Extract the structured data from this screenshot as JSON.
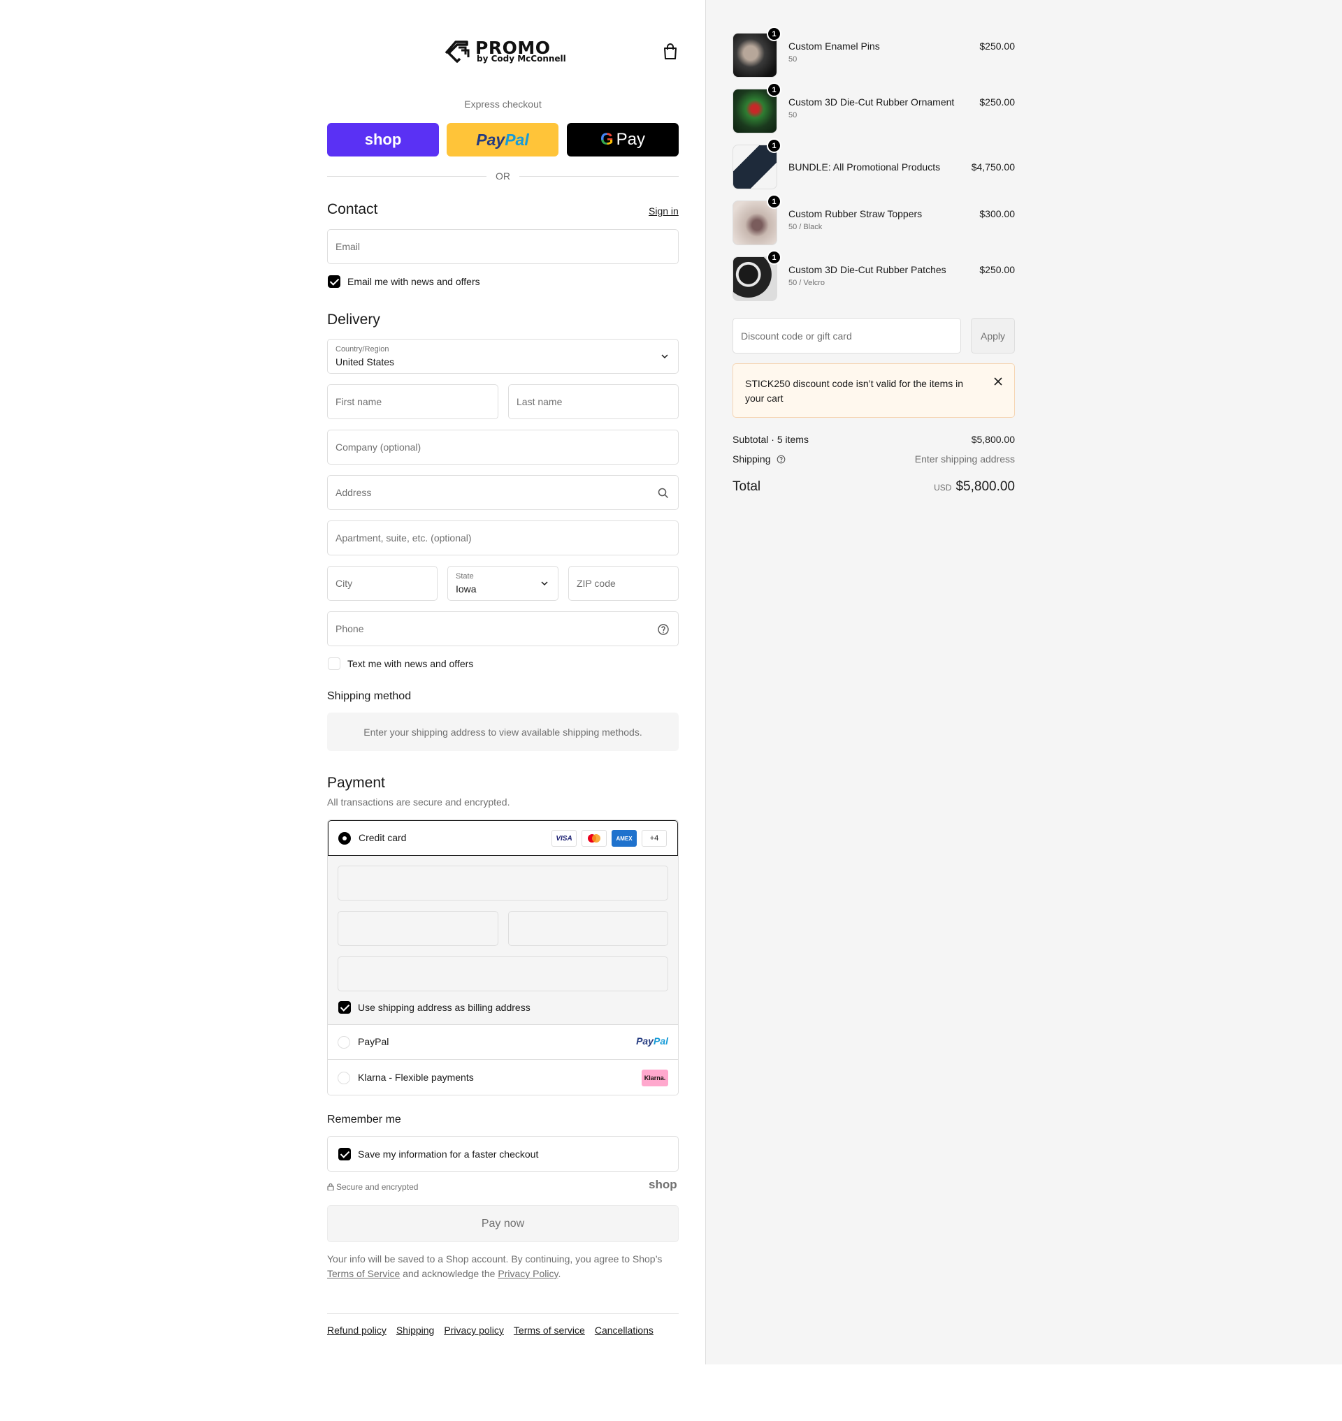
{
  "header": {
    "brand": "PROMO",
    "brand_sub": "by Cody McConnell"
  },
  "express": {
    "label": "Express checkout",
    "shop_label": "shop",
    "paypal_a": "Pay",
    "paypal_b": "Pal",
    "gpay_g": "G",
    "gpay_label": "Pay",
    "or_label": "OR"
  },
  "contact": {
    "title": "Contact",
    "sign_in": "Sign in",
    "email_placeholder": "Email",
    "news_label": "Email me with news and offers"
  },
  "delivery": {
    "title": "Delivery",
    "country_label": "Country/Region",
    "country_value": "United States",
    "first_name": "First name",
    "last_name": "Last name",
    "company": "Company (optional)",
    "address": "Address",
    "apartment": "Apartment, suite, etc. (optional)",
    "city": "City",
    "state_label": "State",
    "state_value": "Iowa",
    "zip": "ZIP code",
    "phone": "Phone",
    "text_label": "Text me with news and offers"
  },
  "shipping": {
    "title": "Shipping method",
    "message": "Enter your shipping address to view available shipping methods."
  },
  "payment": {
    "title": "Payment",
    "subtitle": "All transactions are secure and encrypted.",
    "credit_card": "Credit card",
    "card_brands": [
      "VISA",
      "MC",
      "AMEX",
      "+4"
    ],
    "billing_same": "Use shipping address as billing address",
    "paypal": "PayPal",
    "paypal_logo_a": "Pay",
    "paypal_logo_b": "Pal",
    "klarna": "Klarna - Flexible payments",
    "klarna_logo": "Klarna."
  },
  "remember": {
    "title": "Remember me",
    "save_label": "Save my information for a faster checkout",
    "secure": "Secure and encrypted",
    "shop": "shop"
  },
  "pay_now": "Pay now",
  "legal": {
    "part1": "Your info will be saved to a Shop account. By continuing, you agree to Shop’s ",
    "tos": "Terms of Service",
    "part2": " and acknowledge the ",
    "privacy": "Privacy Policy",
    "part3": "."
  },
  "footer": [
    "Refund policy",
    "Shipping",
    "Privacy policy",
    "Terms of service",
    "Cancellations"
  ],
  "cart": {
    "items": [
      {
        "name": "Custom Enamel Pins",
        "variant": "50",
        "price": "$250.00",
        "qty": "1"
      },
      {
        "name": "Custom 3D Die-Cut Rubber Ornament",
        "variant": "50",
        "price": "$250.00",
        "qty": "1"
      },
      {
        "name": "BUNDLE: All Promotional Products",
        "variant": "",
        "price": "$4,750.00",
        "qty": "1"
      },
      {
        "name": "Custom Rubber Straw Toppers",
        "variant": "50 / Black",
        "price": "$300.00",
        "qty": "1"
      },
      {
        "name": "Custom 3D Die-Cut Rubber Patches",
        "variant": "50 / Velcro",
        "price": "$250.00",
        "qty": "1"
      }
    ],
    "discount_placeholder": "Discount code or gift card",
    "apply": "Apply",
    "error": "STICK250 discount code isn’t valid for the items in your cart",
    "subtotal_label": "Subtotal · 5 items",
    "subtotal_value": "$5,800.00",
    "shipping_label": "Shipping",
    "shipping_value": "Enter shipping address",
    "total_label": "Total",
    "currency": "USD",
    "total_value": "$5,800.00"
  },
  "colors": {
    "shop_purple": "#5a31f4",
    "paypal_yellow": "#ffc439",
    "accent_black": "#000000",
    "error_bg": "#fff8ee"
  }
}
